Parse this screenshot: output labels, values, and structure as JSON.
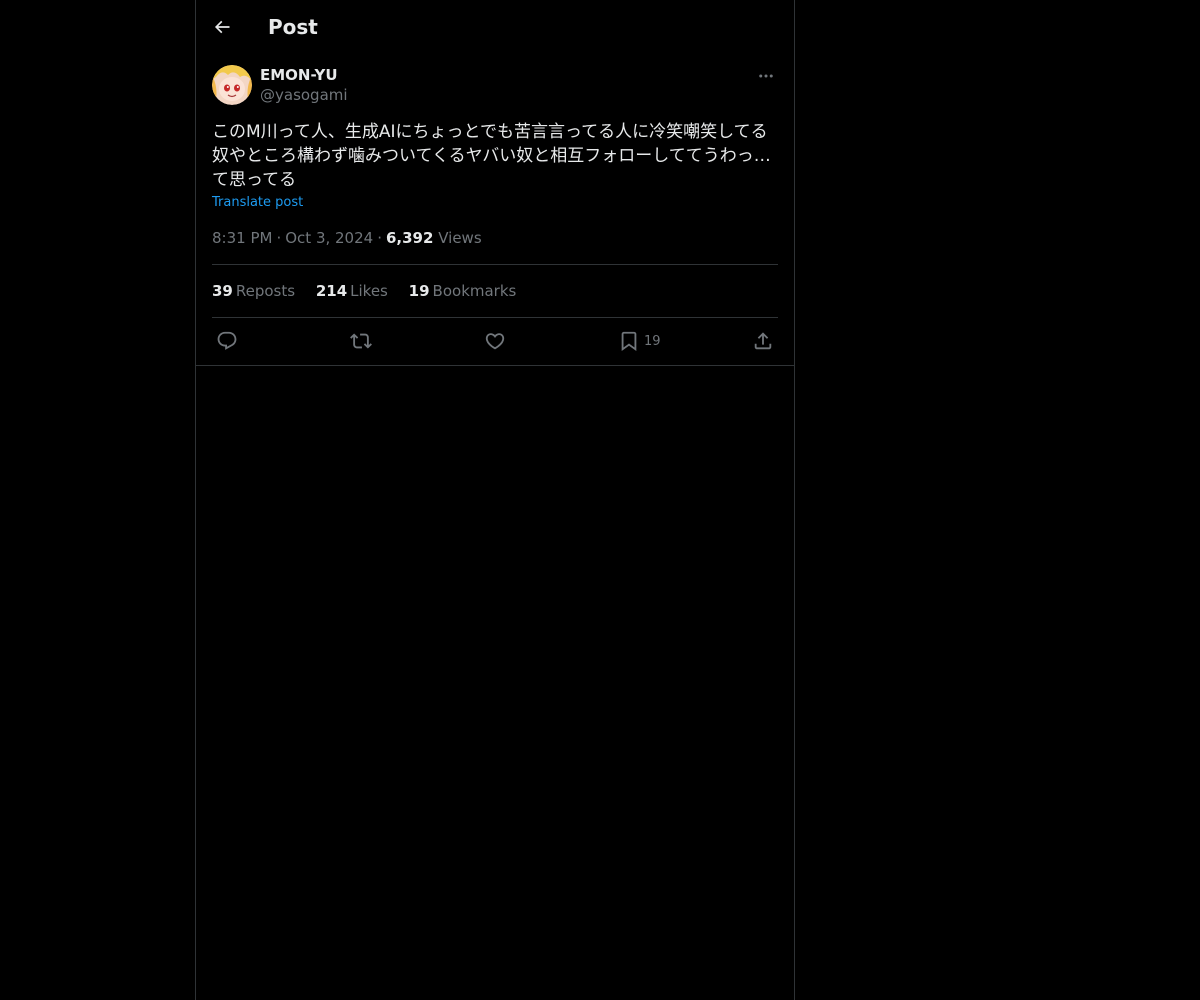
{
  "header": {
    "title": "Post",
    "back_icon": "arrow-left-icon"
  },
  "post": {
    "author": {
      "display_name": "EMON-YU",
      "handle": "@yasogami",
      "avatar": "avatar-image"
    },
    "text": "このM川って人、生成AIにちょっとでも苦言言ってる人に冷笑嘲笑してる奴やところ構わず噛みついてくるヤバい奴と相互フォローしててうわっ…て思ってる",
    "translate_label": "Translate post",
    "time": "8:31 PM",
    "date": "Oct 3, 2024",
    "views_count": "6,392",
    "views_label": "Views",
    "separator": "·"
  },
  "stats": {
    "reposts_count": "39",
    "reposts_label": "Reposts",
    "likes_count": "214",
    "likes_label": "Likes",
    "bookmarks_count": "19",
    "bookmarks_label": "Bookmarks"
  },
  "actions": {
    "reply_icon": "reply-icon",
    "repost_icon": "repost-icon",
    "like_icon": "heart-icon",
    "bookmark_icon": "bookmark-icon",
    "bookmark_count": "19",
    "share_icon": "share-icon"
  },
  "colors": {
    "background": "#000000",
    "text": "#e7e9ea",
    "secondary": "#71767b",
    "link": "#1d9bf0",
    "border": "#2f3336"
  }
}
